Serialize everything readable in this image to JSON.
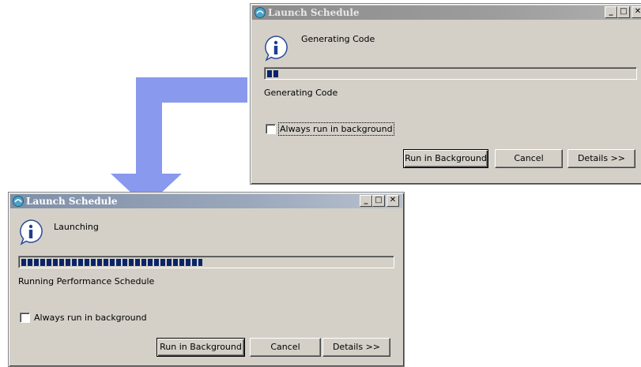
{
  "dialog_top": {
    "title": "Launch Schedule",
    "message": "Generating Code",
    "progress_fraction": 0.03,
    "status": "Generating Code",
    "checkbox_label": "Always run in background",
    "checkbox_checked": false,
    "buttons": {
      "run_background": "Run in Background",
      "cancel": "Cancel",
      "details": "Details >>"
    }
  },
  "dialog_bottom": {
    "title": "Launch Schedule",
    "message": "Launching",
    "progress_fraction": 0.49,
    "status": "Running Performance Schedule",
    "checkbox_label": "Always run in background",
    "checkbox_checked": false,
    "buttons": {
      "run_background": "Run in Background",
      "cancel": "Cancel",
      "details": "Details >>"
    }
  },
  "window_controls": {
    "minimize": "_",
    "maximize": "□",
    "close": "✕"
  },
  "icons": {
    "app": "schedule-app-icon",
    "info": "info-icon",
    "transition": "flow-arrow"
  },
  "colors": {
    "dialog_bg": "#d4d0c8",
    "titlebar": "#0a246a",
    "progress": "#0a246a",
    "arrow": "#8899ee"
  }
}
